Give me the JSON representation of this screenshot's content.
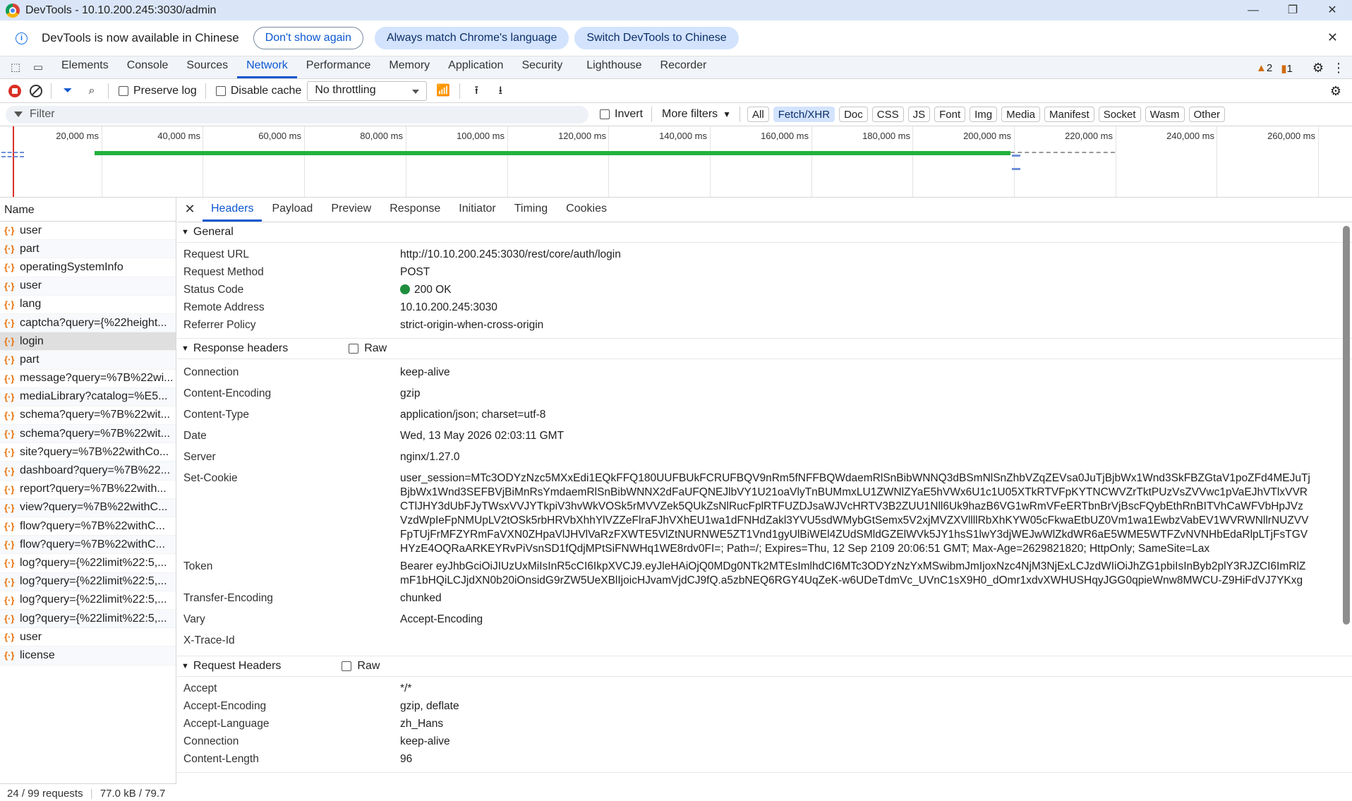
{
  "window": {
    "title": "DevTools - 10.10.200.245:3030/admin",
    "minimize": "—",
    "restore": "❐",
    "close": "✕"
  },
  "infobar": {
    "message": "DevTools is now available in Chinese",
    "btn_dont_show": "Don't show again",
    "btn_match": "Always match Chrome's language",
    "btn_switch": "Switch DevTools to Chinese",
    "close": "✕"
  },
  "panel_tabs": [
    "Elements",
    "Console",
    "Sources",
    "Network",
    "Performance",
    "Memory",
    "Application",
    "Security",
    "Lighthouse",
    "Recorder"
  ],
  "active_panel": "Network",
  "issues": {
    "warnings": "2",
    "errors": "1"
  },
  "toolbar": {
    "preserve_log": "Preserve log",
    "disable_cache": "Disable cache",
    "throttling": "No throttling"
  },
  "filter": {
    "placeholder": "Filter",
    "invert": "Invert",
    "more_filters": "More filters",
    "types": [
      "All",
      "Fetch/XHR",
      "Doc",
      "CSS",
      "JS",
      "Font",
      "Img",
      "Media",
      "Manifest",
      "Socket",
      "Wasm",
      "Other"
    ],
    "active_type": "Fetch/XHR"
  },
  "overview": {
    "ticks": [
      "20,000 ms",
      "40,000 ms",
      "60,000 ms",
      "80,000 ms",
      "100,000 ms",
      "120,000 ms",
      "140,000 ms",
      "160,000 ms",
      "180,000 ms",
      "200,000 ms",
      "220,000 ms",
      "240,000 ms",
      "260,000 ms"
    ]
  },
  "requests": {
    "header": "Name",
    "items": [
      "user",
      "part",
      "operatingSystemInfo",
      "user",
      "lang",
      "captcha?query={%22height...",
      "login",
      "part",
      "message?query=%7B%22wi...",
      "mediaLibrary?catalog=%E5...",
      "schema?query=%7B%22wit...",
      "schema?query=%7B%22wit...",
      "site?query=%7B%22withCo...",
      "dashboard?query=%7B%22...",
      "report?query=%7B%22with...",
      "view?query=%7B%22withC...",
      "flow?query=%7B%22withC...",
      "flow?query=%7B%22withC...",
      "log?query={%22limit%22:5,...",
      "log?query={%22limit%22:5,...",
      "log?query={%22limit%22:5,...",
      "log?query={%22limit%22:5,...",
      "user",
      "license"
    ],
    "selected": "login"
  },
  "statusbar": {
    "requests": "24 / 99 requests",
    "size": "77.0 kB / 79.7"
  },
  "detail_tabs": [
    "Headers",
    "Payload",
    "Preview",
    "Response",
    "Initiator",
    "Timing",
    "Cookies"
  ],
  "active_detail_tab": "Headers",
  "general": {
    "title": "General",
    "request_url_label": "Request URL",
    "request_url": "http://10.10.200.245:3030/rest/core/auth/login",
    "request_method_label": "Request Method",
    "request_method": "POST",
    "status_code_label": "Status Code",
    "status_code": "200 OK",
    "remote_address_label": "Remote Address",
    "remote_address": "10.10.200.245:3030",
    "referrer_policy_label": "Referrer Policy",
    "referrer_policy": "strict-origin-when-cross-origin"
  },
  "response_headers": {
    "title": "Response headers",
    "raw": "Raw",
    "items": [
      {
        "k": "Connection",
        "v": "keep-alive"
      },
      {
        "k": "Content-Encoding",
        "v": "gzip"
      },
      {
        "k": "Content-Type",
        "v": "application/json; charset=utf-8"
      },
      {
        "k": "Date",
        "v": "Wed, 13 May 2026 02:03:11 GMT"
      },
      {
        "k": "Server",
        "v": "nginx/1.27.0"
      },
      {
        "k": "Set-Cookie",
        "v": "user_session=MTc3ODYzNzc5MXxEdi1EQkFFQ180UUFBUkFCRUFBQV9nRm5fNFFBQWdaemRlSnBibWNNQ3dBSmNlSnZhbVZqZEVsa0JuTjBjbWx1Wnd3SkFBZGtaV1poZFd4MEJuTjBjbWx1Wnd3SEFBVjBiMnRsYmdaemRlSnBibWNNX2dFaUFQNEJlbVY1U21oaVlyTnBUMmxLU1ZWNlZYaE5hVWx6U1c1U05XTkRTVFpKYTNCWVZrTktPUzVsZVVwc1pVaEJhVTlxVVRCTlJHY3dUbFJyTWsxVVJYTkpiV3hvWkVOSk5rMVVZek5QUkZsNlRucFplRTFUZDJsaWJVcHRTV3B2ZUU1Nll6Uk9hazB6VG1wRmVFeERTbnBrVjBscFQybEthRnBITVhCaWFVbHpJVzVzdWpIeFpNMUpLV2tOSk5rbHRVbXhhYlVZZeFlraFJhVXhEU1wa1dFNHdZakl3YVU5sdWMybGtSemx5V2xjMVZXVllllRbXhKYW05cFkwaEtbUZ0Vm1wa1EwbzVabEV1WVRWNllrNUZVVFpTUjFrMFZYRmFaVXN0ZHpaVlJHVlVaRzFXWTE5VlZtNURNWE5ZT1Vnd1gyUlBiWEl4ZUdSMldGZElWVk5JY1hsS1lwY3djWEJwWlZkdWR6aE5WME5WTFZvNVNHbEdaRlpLTjFsTGVHYzE4OQRaARKEYRvPiVsnSD1fQdjMPtSiFNWHq1WE8rdv0FI=; Path=/; Expires=Thu, 12 Sep 2109 20:06:51 GMT; Max-Age=2629821820; HttpOnly; SameSite=Lax"
      },
      {
        "k": "Token",
        "v": "Bearer eyJhbGciOiJIUzUxMiIsInR5cCI6IkpXVCJ9.eyJleHAiOjQ0MDg0NTk2MTEsImlhdCI6MTc3ODYzNzYxMSwibmJmIjoxNzc4NjM3NjExLCJzdWIiOiJhZG1pbiIsInByb2plY3RJZCI6ImRlZmF1bHQiLCJjdXN0b20iOnsidG9rZW5UeXBlIjoicHJvamVjdCJ9fQ.a5zbNEQ6RGY4UqZeK-w6UDeTdmVc_UVnC1sX9H0_dOmr1xdvXWHUSHqyJGG0qpieWnw8MWCU-Z9HiFdVJ7YKxg"
      },
      {
        "k": "Transfer-Encoding",
        "v": "chunked"
      },
      {
        "k": "Vary",
        "v": "Accept-Encoding"
      },
      {
        "k": "X-Trace-Id",
        "v": ""
      }
    ]
  },
  "request_headers": {
    "title": "Request Headers",
    "raw": "Raw",
    "items": [
      {
        "k": "Accept",
        "v": "*/*"
      },
      {
        "k": "Accept-Encoding",
        "v": "gzip, deflate"
      },
      {
        "k": "Accept-Language",
        "v": "zh_Hans"
      },
      {
        "k": "Connection",
        "v": "keep-alive"
      },
      {
        "k": "Content-Length",
        "v": "96"
      }
    ]
  }
}
